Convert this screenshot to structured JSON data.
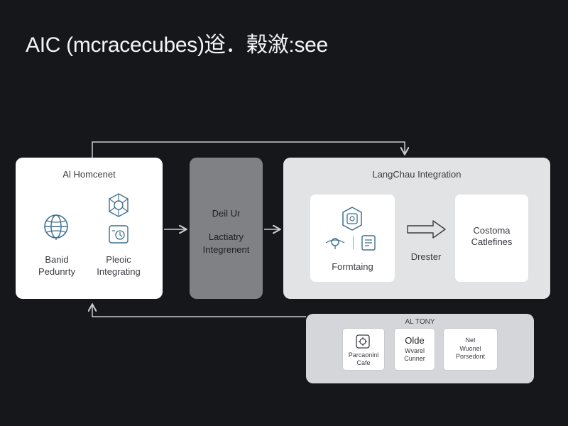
{
  "title": "AIC (mcracecubes)逧．榖漵:see",
  "colors": {
    "background": "#16171b",
    "panel_white": "#ffffff",
    "panel_gray": "#7f8185",
    "panel_light": "#e2e3e5",
    "connector": "#c9cbd0"
  },
  "panel_a": {
    "heading": "Al Homcenet",
    "item_left": {
      "icon": "globe-icon",
      "line1": "Banid",
      "line2": "Pedunrty"
    },
    "item_right": {
      "icon": "network-node-icon",
      "icon2": "clock-panel-icon",
      "line1": "Pleoic",
      "line2": "Integrating"
    }
  },
  "panel_b": {
    "line1": "Deil Ur",
    "line2": "Lactiatry",
    "line3": "Integrenent"
  },
  "panel_c": {
    "heading": "LangChau Integration",
    "formatting_card": {
      "icon": "hexagon-chip-icon",
      "icon_left": "location-pin-icon",
      "icon_right": "document-grid-icon",
      "label": "Formtaing"
    },
    "arrow_label": "Drester",
    "custom_card": {
      "line1": "Costoma",
      "line2": "Catlefines"
    }
  },
  "panel_d": {
    "heading": "AL TONY",
    "items": [
      {
        "icon": "gear-doc-icon",
        "line1": "Parcaoninl",
        "line2": "Cafe"
      },
      {
        "line1": "Olde",
        "line2": "Wvarel",
        "line3": "Cunner"
      },
      {
        "line1": "Net",
        "line2": "Wuonel",
        "line3": "Porsedont"
      }
    ]
  }
}
